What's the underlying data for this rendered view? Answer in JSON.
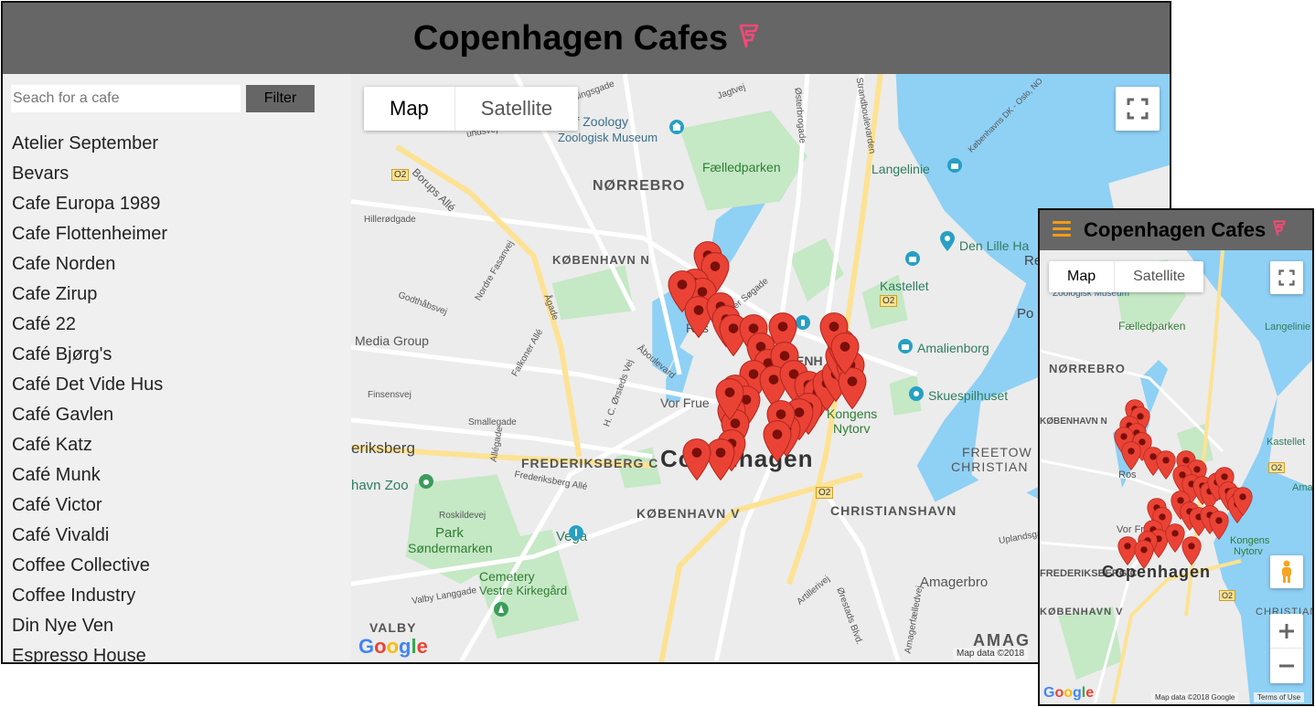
{
  "app": {
    "title": "Copenhagen Cafes",
    "logo_icon": "foursquare-icon",
    "logo_color": "#f94877",
    "header_color": "#666666",
    "menu_color": "#f39c12"
  },
  "search": {
    "placeholder": "Seach for a cafe",
    "value": "",
    "filter_label": "Filter"
  },
  "cafes": [
    "Atelier September",
    "Bevars",
    "Cafe Europa 1989",
    "Cafe Flottenheimer",
    "Cafe Norden",
    "Cafe Zirup",
    "Café 22",
    "Café Bjørg's",
    "Café Det Vide Hus",
    "Café Gavlen",
    "Café Katz",
    "Café Munk",
    "Café Victor",
    "Café Vivaldi",
    "Coffee Collective",
    "Coffee Industry",
    "Din Nye Ven",
    "Espresso House"
  ],
  "map": {
    "type_map": "Map",
    "type_satellite": "Satellite",
    "attribution_desktop": "Map data ©2018",
    "attribution_mobile": "Map data ©2018 Google",
    "terms": "Terms of Use",
    "google_logo": [
      "G",
      "o",
      "o",
      "g",
      "l",
      "e"
    ],
    "labels": {
      "norrebro": "NØRREBRO",
      "kobenhavn_n": "KØBENHAVN N",
      "faelledparken": "Fælledparken",
      "zoology": "n of Zoology",
      "zoologisk": "Zoologisk Museum",
      "langelinie": "Langelinie",
      "den_lille": "Den Lille Ha",
      "kastellet": "Kastellet",
      "amalienborg": "Amalienborg",
      "skuespilhuset": "Skuespilhuset",
      "media_group": "Media Group",
      "frederiksberg": "eriksberg",
      "frederiksberg_c": "FREDERIKSBERG C",
      "copenhagen": "Copenhagen",
      "kongens": "Kongens",
      "nytorv": "Nytorv",
      "freetown": "FREETOW",
      "christiania": "CHRISTIAN",
      "christianshavn": "CHRISTIANSHAVN",
      "kobenhavn_v": "KØBENHAVN V",
      "zoo": "havn Zoo",
      "vega": "Vega",
      "park": "Park",
      "sondermarken": "Søndermarken",
      "cemetery": "Cemetery",
      "vestre": "Vestre Kirkegård",
      "amagerbro": "Amagerbro",
      "valby": "VALBY",
      "amag": "AMAG",
      "vor_frue": "Vor Frue",
      "rose": "Ros",
      "enhavn": "ENH",
      "enhavn_k": "K",
      "borups_alle": "Borups Allé",
      "oster_sogade": "Øster Søgade",
      "jagtvej": "Jagtvej",
      "osterbrogade": "Østerbrogade",
      "strandboulevarden": "Strandboulevarden",
      "o2": "O2",
      "road1": "Rovsingsgade",
      "road2": "Hillerødgade",
      "road3": "Godthåbsvej",
      "road4": "Nordre Fasanvej",
      "road5": "Finsensvej",
      "road6": "Smallegade",
      "road7": "Frederiksberg Allé",
      "road8": "Roskildevej",
      "road9": "Valby Langgade",
      "road10": "Åboulevard",
      "road11": "Falkoner Allé",
      "road12": "Ågade",
      "road13": "H. C. Ørsteds Vej",
      "road14": "Allégade",
      "road15": "Ørestads Blvd.",
      "road16": "Artillerivej",
      "road17": "Amagerfælledvej",
      "road18": "Uplandsga",
      "road19": "Københavns DK - Oslo, NO",
      "road20": "undsvej",
      "road21": "Po",
      "road22": "Re"
    },
    "colors": {
      "land": "#ececec",
      "water": "#8fd0f5",
      "park": "#c5e8c5",
      "road_major": "#fde293",
      "road": "#ffffff",
      "marker": "#ea4335"
    }
  }
}
